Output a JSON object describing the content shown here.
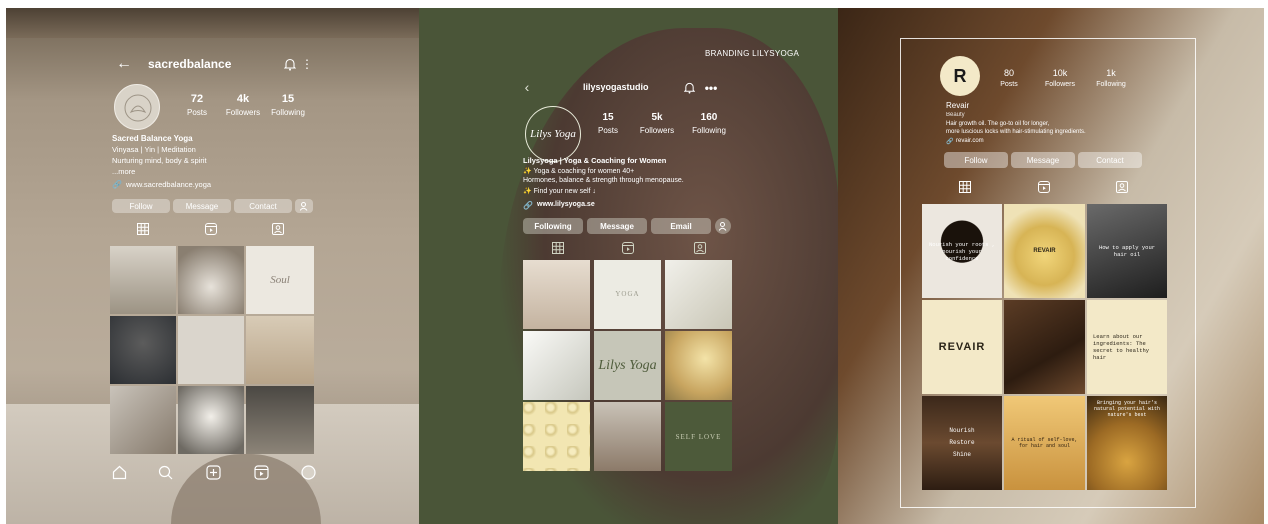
{
  "p1": {
    "username": "sacredbalance",
    "stats": [
      {
        "value": "72",
        "label": "Posts"
      },
      {
        "value": "4k",
        "label": "Followers"
      },
      {
        "value": "15",
        "label": "Following"
      }
    ],
    "name": "Sacred Balance Yoga",
    "bio1": "Vinyasa | Yin | Meditation",
    "bio2": "Nurturing mind, body & spirit",
    "more": "...more",
    "link": "www.sacredbalance.yoga",
    "buttons": {
      "follow": "Follow",
      "message": "Message",
      "contact": "Contact"
    },
    "tile_text": {
      "soul": "Soul"
    }
  },
  "p2": {
    "header": "BRANDING LILYSYOGA",
    "username": "lilysyogastudio",
    "avatar_text": "Lilys Yoga",
    "stats": [
      {
        "value": "15",
        "label": "Posts"
      },
      {
        "value": "5k",
        "label": "Followers"
      },
      {
        "value": "160",
        "label": "Following"
      }
    ],
    "name": "Lilysyoga | Yoga & Coaching for Women",
    "bio1": "✨ Yoga & coaching for women 40+",
    "bio2": "Hormones, balance & strength through menopause.",
    "bio3": "✨ Find your new self ↓",
    "link": "www.lilysyoga.se",
    "buttons": {
      "following": "Following",
      "message": "Message",
      "email": "Email"
    },
    "tile_text": {
      "center": "Lilys Yoga",
      "yoga": "YOGA",
      "self": "SELF LOVE"
    }
  },
  "p3": {
    "avatar_letter": "R",
    "stats": [
      {
        "value": "80",
        "label": "Posts"
      },
      {
        "value": "10k",
        "label": "Followers"
      },
      {
        "value": "1k",
        "label": "Following"
      }
    ],
    "name": "Revair",
    "category": "Beauty",
    "bio1": "Hair growth oil. The go-to oil for longer,",
    "bio2": "more luscious locks with hair-stimulating ingredients.",
    "link": "revair.com",
    "buttons": {
      "follow": "Follow",
      "message": "Message",
      "contact": "Contact"
    },
    "tiles": {
      "t1": "Nourish your roots , nourish your confidence",
      "t2": "REVAIR",
      "t3": "How to apply your hair oil",
      "t4": "REVAIR",
      "t6": "Learn about our ingredients: The secret to healthy hair",
      "t7a": "Nourish",
      "t7b": "Restore",
      "t7c": "Shine",
      "t8": "A ritual of self-love, for hair and soul",
      "t9": "Bringing your hair's natural potential with nature's best"
    }
  },
  "colors": {
    "p1_bg": "#b4a694",
    "p2_bg": "#4a5538",
    "p3_cream": "#f3e9c8"
  }
}
